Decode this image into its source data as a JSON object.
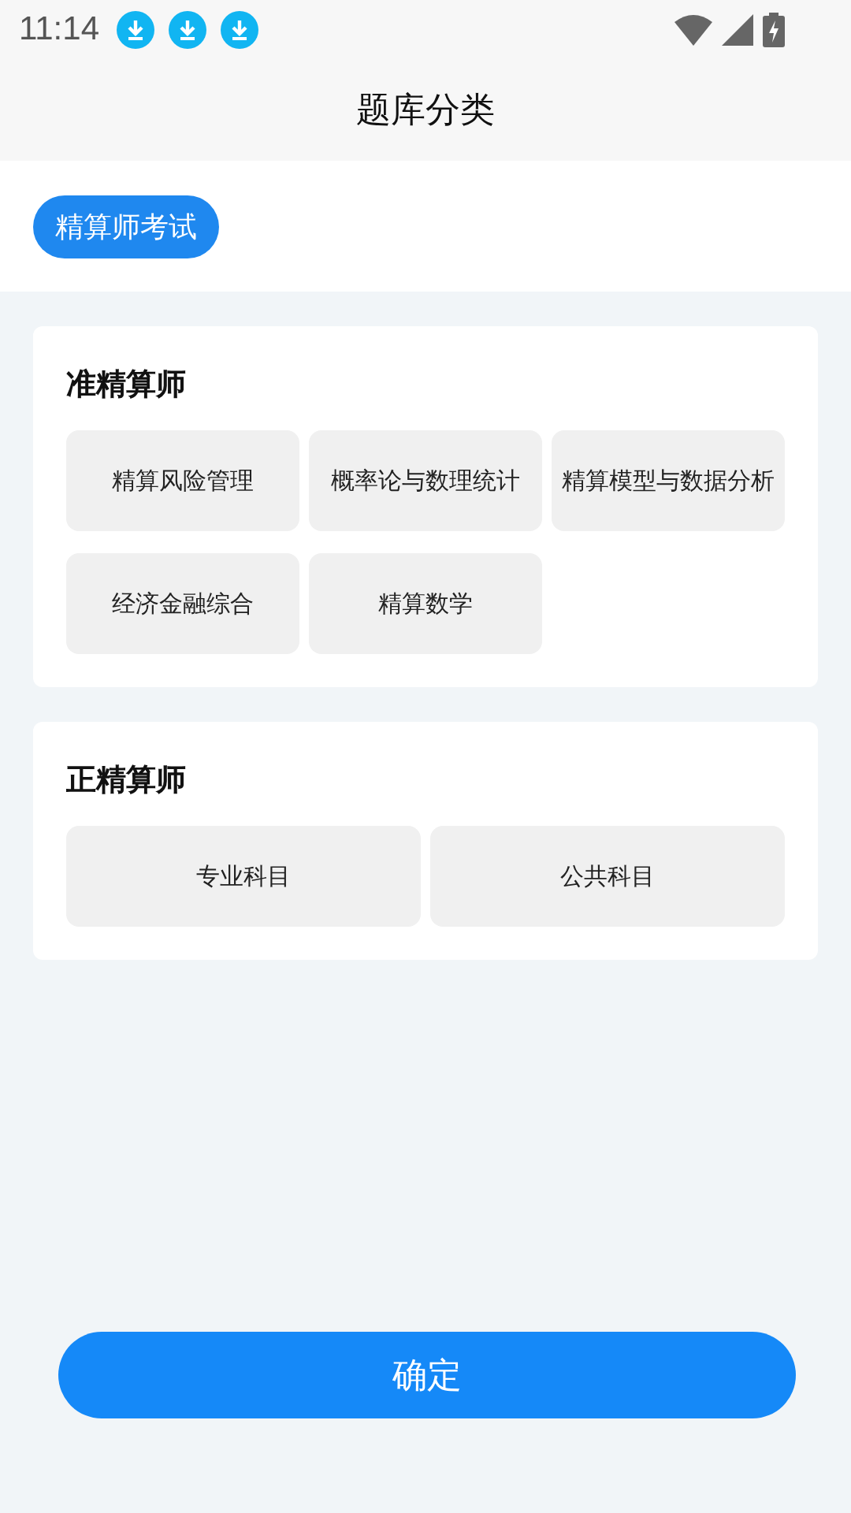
{
  "status_bar": {
    "time": "11:14"
  },
  "header": {
    "title": "题库分类"
  },
  "tabs": [
    {
      "label": "精算师考试",
      "selected": true
    }
  ],
  "sections": [
    {
      "title": "准精算师",
      "items": [
        {
          "label": "精算风险管理",
          "selected": false
        },
        {
          "label": "概率论与数理统计",
          "selected": false
        },
        {
          "label": "精算模型与数据分析",
          "selected": false
        },
        {
          "label": "经济金融综合",
          "selected": false
        },
        {
          "label": "精算数学",
          "selected": false
        }
      ]
    },
    {
      "title": "正精算师",
      "items": [
        {
          "label": "专业科目",
          "selected": false
        },
        {
          "label": "公共科目",
          "selected": false
        }
      ]
    }
  ],
  "confirm_button": {
    "label": "确定"
  }
}
